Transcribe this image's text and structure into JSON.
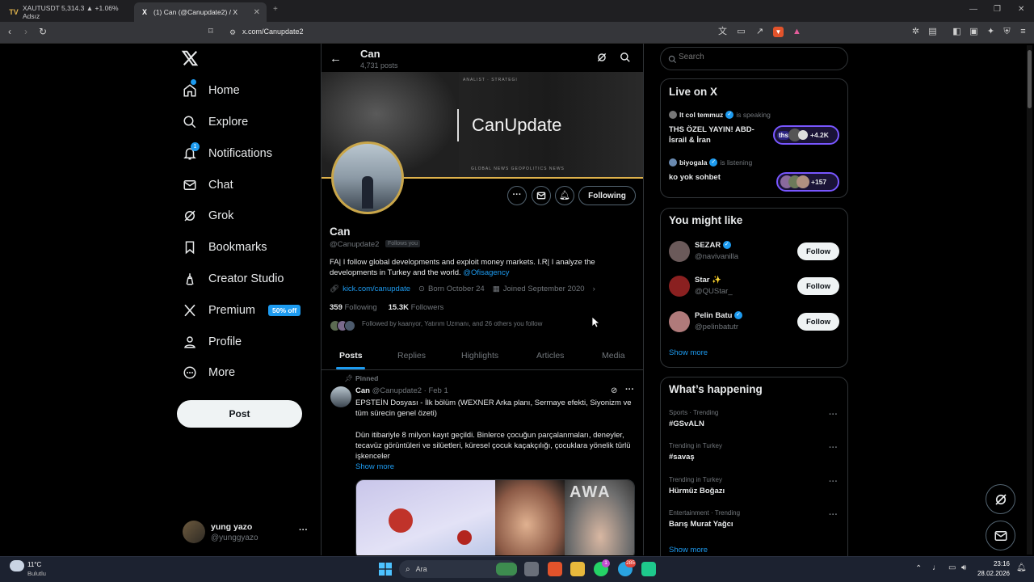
{
  "browser": {
    "tab1": "XAUTUSDT 5,314.3 ▲ +1.06% Adsız",
    "tab1_icon": "TV",
    "tab2": "(1) Can (@Canupdate2) / X",
    "tab2_icon": "X",
    "url": "x.com/Canupdate2"
  },
  "nav": {
    "items": [
      "Home",
      "Explore",
      "Notifications",
      "Chat",
      "Grok",
      "Bookmarks",
      "Creator Studio",
      "Premium",
      "Profile",
      "More"
    ],
    "premium_badge": "50% off",
    "notif_count": "1",
    "post": "Post",
    "account_name": "yung yazo",
    "account_handle": "@yunggyazo"
  },
  "header": {
    "name": "Can",
    "posts": "4,731 posts"
  },
  "banner": {
    "text": "CanUpdate",
    "top": "ANALIST · STRATEGI",
    "bottom": "GLOBAL NEWS     GEOPOLITICS     NEWS"
  },
  "profile": {
    "following_btn": "Following",
    "name": "Can",
    "handle": "@Canupdate2",
    "follows_you": "Follows you",
    "bio": "FA| I follow global developments and exploit money markets. I.R| I analyze the developments in Turkey and the world.",
    "bio_link": "@Ofisagency",
    "website": "kick.com/canupdate",
    "born": "Born October 24",
    "joined": "Joined September 2020",
    "following_count": "359",
    "following_label": "Following",
    "followers_count": "15.3K",
    "followers_label": "Followers",
    "followed_by": "Followed by kaanyor, Yatırım Uzmanı, and 26 others you follow"
  },
  "tabs": [
    "Posts",
    "Replies",
    "Highlights",
    "Articles",
    "Media"
  ],
  "post": {
    "pinned": "Pinned",
    "name": "Can",
    "handle_date": "@Canupdate2 · Feb 1",
    "title": "EPSTEİN Dosyası - İlk bölüm (WEXNER Arka planı, Sermaye efekti, Siyonizm ve tüm sürecin genel özeti)",
    "body": "Dün itibariyle 8 milyon kayıt geçildi. Binlerce çocuğun parçalanmaları, deneyler, tecavüz görüntüleri ve silüetleri, küresel çocuk kaçakçılığı, çocuklara yönelik türlü işkenceler",
    "show_more": "Show more",
    "img_text": "AWA"
  },
  "search": {
    "placeholder": "Search"
  },
  "live": {
    "title": "Live on X",
    "items": [
      {
        "host": "lt col temmuz",
        "status": "is speaking",
        "title": "THS ÖZEL YAYIN! ABD-İsrail & İran",
        "count": "+4.2K",
        "pill": "ths"
      },
      {
        "host": "biyogala",
        "status": "is listening",
        "title": "ko yok sohbet",
        "count": "+157"
      }
    ]
  },
  "might_like": {
    "title": "You might like",
    "users": [
      {
        "name": "SEZAR",
        "handle": "@navivanilla",
        "btn": "Follow",
        "color": "#6b5a5a"
      },
      {
        "name": "Star ✨",
        "handle": "@QUStar_",
        "btn": "Follow",
        "color": "#8a2020"
      },
      {
        "name": "Pelin Batu",
        "handle": "@pelinbatutr",
        "btn": "Follow",
        "color": "#b07a7a"
      }
    ],
    "show_more": "Show more"
  },
  "happening": {
    "title": "What’s happening",
    "items": [
      {
        "meta": "Sports · Trending",
        "topic": "#GSvALN"
      },
      {
        "meta": "Trending in Turkey",
        "topic": "#savaş"
      },
      {
        "meta": "Trending in Turkey",
        "topic": "Hürmüz Boğazı"
      },
      {
        "meta": "Entertainment · Trending",
        "topic": "Barış Murat Yağcı"
      }
    ],
    "show_more": "Show more"
  },
  "taskbar": {
    "weather_temp": "11°C",
    "weather_desc": "Bulutlu",
    "search": "Ara",
    "time": "23:16",
    "date": "28.02.2026",
    "whatsapp_badge": "1",
    "telegram_badge": "285"
  },
  "colors": {
    "accent": "#1d9bf0",
    "banner_line": "#e0b34c",
    "bg": "#000000",
    "border": "#2f3336"
  }
}
